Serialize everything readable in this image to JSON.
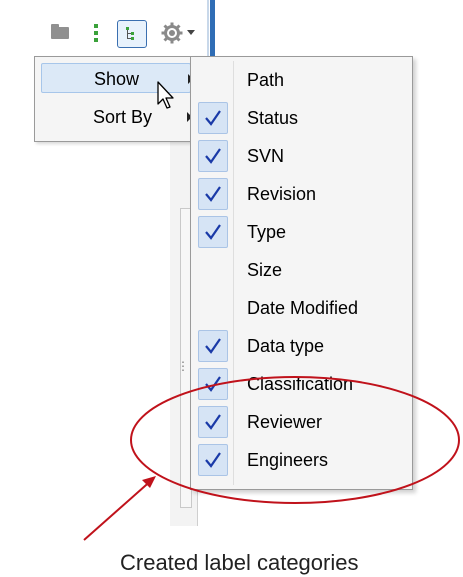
{
  "toolbar": {
    "icons": [
      "folder-icon",
      "dots-icon",
      "tree-view-icon",
      "gear-icon",
      "dropdown-caret-icon"
    ]
  },
  "menu1": {
    "items": [
      {
        "label": "Show",
        "highlighted": true,
        "has_submenu": true
      },
      {
        "label": "Sort By",
        "highlighted": false,
        "has_submenu": true
      }
    ]
  },
  "menu2": {
    "items": [
      {
        "label": "Path",
        "checked": false
      },
      {
        "label": "Status",
        "checked": true
      },
      {
        "label": "SVN",
        "checked": true
      },
      {
        "label": "Revision",
        "checked": true
      },
      {
        "label": "Type",
        "checked": true
      },
      {
        "label": "Size",
        "checked": false
      },
      {
        "label": "Date Modified",
        "checked": false
      },
      {
        "label": "Data type",
        "checked": true
      },
      {
        "label": "Classification",
        "checked": true
      },
      {
        "label": "Reviewer",
        "checked": true
      },
      {
        "label": "Engineers",
        "checked": true
      }
    ]
  },
  "annotation": {
    "caption": "Created label categories",
    "color": "#c0121b"
  },
  "colors": {
    "accent": "#2f6db5",
    "check": "#1a3aa8",
    "highlight": "#dce9f7"
  }
}
